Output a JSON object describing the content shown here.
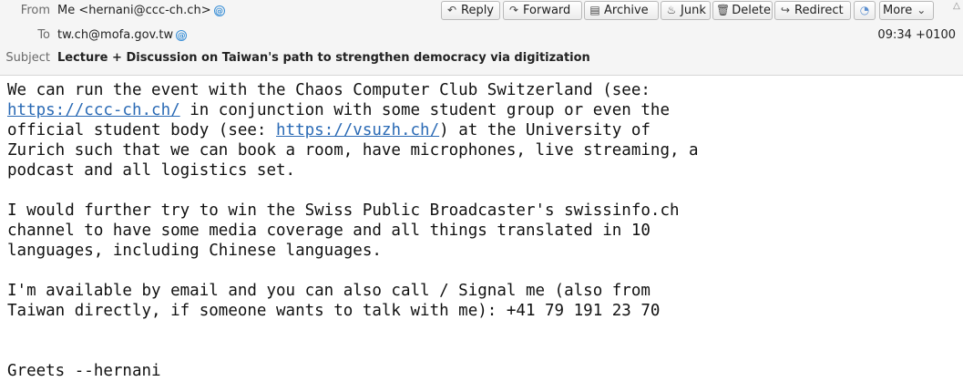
{
  "header": {
    "from_label": "From",
    "from_value": "Me <hernani@ccc-ch.ch>",
    "to_label": "To",
    "to_value": "tw.ch@mofa.gov.tw",
    "subject_label": "Subject",
    "subject_value": "Lecture + Discussion on Taiwan's path to strengthen democracy via digitization",
    "date": "09:34 +0100"
  },
  "toolbar": {
    "reply": "Reply",
    "forward": "Forward",
    "archive": "Archive",
    "junk": "Junk",
    "delete": "Delete",
    "redirect": "Redirect",
    "more": "More"
  },
  "body": {
    "p1_l1": "We can run the event with the Chaos Computer Club Switzerland (see:",
    "link1": "https://ccc-ch.ch/",
    "p1_l2_rest": " in conjunction with some student group or even the",
    "p1_l3_pre": "official student body (see: ",
    "link2": "https://vsuzh.ch/",
    "p1_l3_post": ") at the University of",
    "p1_l4": "Zurich such that we can book a room, have microphones, live streaming, a",
    "p1_l5": "podcast and all logistics set.",
    "p2_l1": "I would further try to win the Swiss Public Broadcaster's swissinfo.ch",
    "p2_l2": "channel to have some media coverage and all things translated in 10",
    "p2_l3": "languages, including Chinese languages.",
    "p3_l1": "I'm available by email and you can also call / Signal me (also from",
    "p3_l2": "Taiwan directly, if someone wants to talk with me): +41 79 191 23 70",
    "sign": "Greets --hernani"
  },
  "colors": {
    "link": "#2a6ab5",
    "header_bg": "#f5f5f5"
  }
}
